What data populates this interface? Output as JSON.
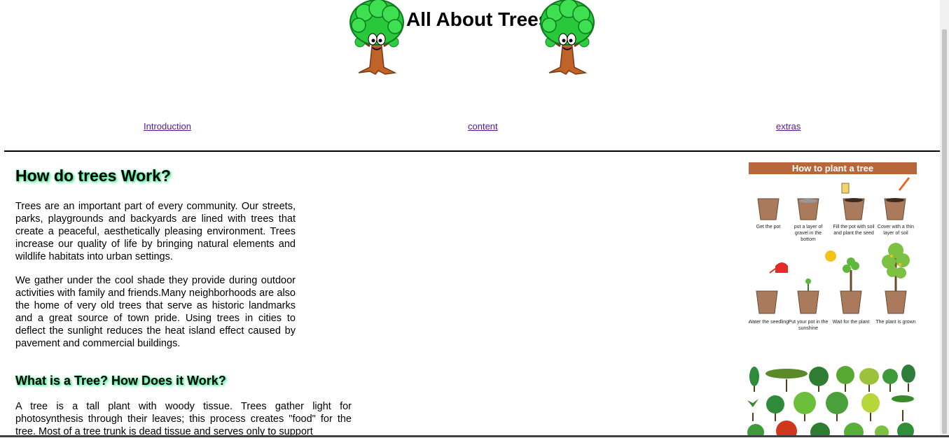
{
  "header": {
    "title": "All About Trees"
  },
  "nav": {
    "items": [
      "Introduction",
      "content",
      "extras"
    ]
  },
  "article": {
    "heading1": "How do trees Work?",
    "paragraph1": "Trees are an important part of every community. Our streets, parks, playgrounds and backyards are lined with trees that create a peaceful, aesthetically pleasing environment. Trees increase our quality of life by bringing natural elements and wildlife habitats into urban settings.",
    "paragraph2": "We gather under the cool shade they provide during outdoor activities with family and friends.Many neighborhoods are also the home of very old trees that serve as historic landmarks and a great source of town pride. Using trees in cities to deflect the sunlight reduces the heat island effect caused by pavement and commercial buildings.",
    "heading2": "What is a Tree? How Does it Work?",
    "paragraph3": "A tree is a tall plant with woody tissue. Trees gather light for photosynthesis through their leaves; this process creates \"food\" for the tree. Most of a tree trunk is dead tissue and serves only to support"
  },
  "howto": {
    "title": "How to plant a tree",
    "steps": [
      "Get the pot",
      "put a layer of gravel in the bottom",
      "Fill the pot with soil and plant the seed",
      "Cover with a thin layer of soil",
      "Water the seedling",
      "Put your pot in the sunshine",
      "Wait for the plant",
      "The plant is grown"
    ]
  },
  "colors": {
    "heading_glow": "#37e58a",
    "link": "#551a8b",
    "banner": "#b8673a"
  }
}
